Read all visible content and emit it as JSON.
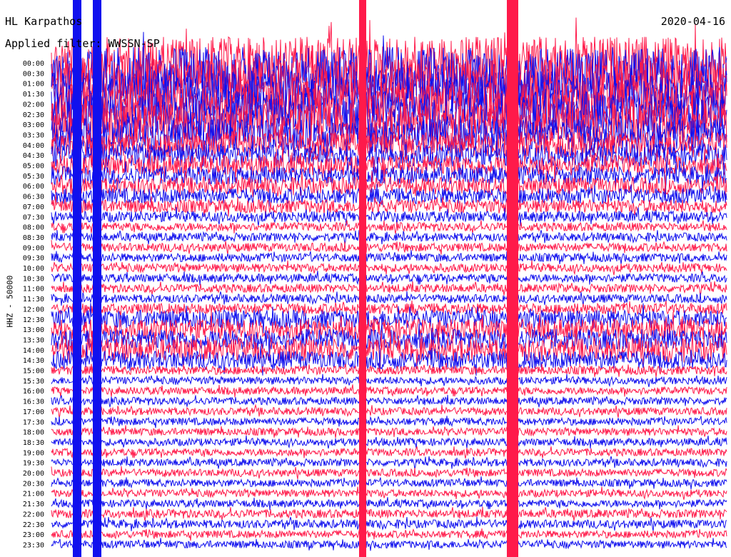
{
  "header": {
    "station": "HL Karpathos",
    "date": "2020-04-16",
    "filter": "Applied filter: WWSSN-SP"
  },
  "chart_data": {
    "type": "line",
    "title": "HL Karpathos",
    "date": "2020-04-16",
    "ylabel": "HHZ - 50000",
    "row_labels": [
      "00:00",
      "00:30",
      "01:00",
      "01:30",
      "02:00",
      "02:30",
      "03:00",
      "03:30",
      "04:00",
      "04:30",
      "05:00",
      "05:30",
      "06:00",
      "06:30",
      "07:00",
      "07:30",
      "08:00",
      "08:30",
      "09:00",
      "09:30",
      "10:00",
      "10:30",
      "11:00",
      "11:30",
      "12:00",
      "12:30",
      "13:00",
      "13:30",
      "14:00",
      "14:30",
      "15:00",
      "15:30",
      "16:00",
      "16:30",
      "17:00",
      "17:30",
      "18:00",
      "18:30",
      "19:00",
      "19:30",
      "20:00",
      "20:30",
      "21:00",
      "21:30",
      "22:00",
      "22:30",
      "23:00",
      "23:30"
    ],
    "series_colors": [
      "#ff1a4a",
      "#1010ee"
    ],
    "trace_colors_order": "alternating starting with red at 00:00",
    "noise_level": [
      1.0,
      1.0,
      0.95,
      0.9,
      0.85,
      0.85,
      0.8,
      0.6,
      0.45,
      0.4,
      0.35,
      0.3,
      0.28,
      0.25,
      0.2,
      0.15,
      0.1,
      0.1,
      0.1,
      0.1,
      0.1,
      0.1,
      0.1,
      0.1,
      0.15,
      0.3,
      0.35,
      0.35,
      0.4,
      0.3,
      0.1,
      0.08,
      0.08,
      0.08,
      0.08,
      0.08,
      0.08,
      0.08,
      0.08,
      0.08,
      0.08,
      0.08,
      0.08,
      0.08,
      0.1,
      0.1,
      0.08,
      0.08
    ]
  }
}
